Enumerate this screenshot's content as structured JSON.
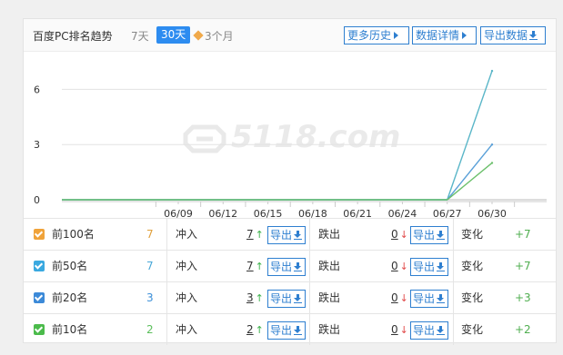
{
  "header": {
    "title": "百度PC排名趋势",
    "ranges": [
      "7天",
      "30天",
      "3个月"
    ],
    "active_range": "30天",
    "buttons": {
      "history": "更多历史",
      "detail": "数据详情",
      "export": "导出数据"
    }
  },
  "watermark": "5118.com",
  "chart_data": {
    "type": "line",
    "x": [
      "06/09",
      "06/12",
      "06/15",
      "06/18",
      "06/21",
      "06/24",
      "06/27",
      "06/30"
    ],
    "yticks": [
      0,
      3,
      6
    ],
    "ylim": [
      0,
      7.5
    ],
    "series": [
      {
        "color": "#5ab6c8",
        "values": [
          0,
          0,
          0,
          0,
          0,
          0,
          0,
          7
        ]
      },
      {
        "color": "#5aa0d8",
        "values": [
          0,
          0,
          0,
          0,
          0,
          0,
          0,
          3
        ]
      },
      {
        "color": "#6cc06c",
        "values": [
          0,
          0,
          0,
          0,
          0,
          0,
          0,
          2
        ]
      }
    ]
  },
  "rows": [
    {
      "label": "前100名",
      "count": "7",
      "count_color": "#e0a03c",
      "check_color": "#f0a33a",
      "rush_label": "冲入",
      "rush": "7",
      "drop_label": "跌出",
      "drop": "0",
      "export": "导出",
      "change_label": "变化",
      "change": "+7"
    },
    {
      "label": "前50名",
      "count": "7",
      "count_color": "#4aa8d8",
      "check_color": "#3aa9e0",
      "rush_label": "冲入",
      "rush": "7",
      "drop_label": "跌出",
      "drop": "0",
      "export": "导出",
      "change_label": "变化",
      "change": "+7"
    },
    {
      "label": "前20名",
      "count": "3",
      "count_color": "#3b8fd8",
      "check_color": "#3c8ad8",
      "rush_label": "冲入",
      "rush": "3",
      "drop_label": "跌出",
      "drop": "0",
      "export": "导出",
      "change_label": "变化",
      "change": "+3"
    },
    {
      "label": "前10名",
      "count": "2",
      "count_color": "#5cbf5c",
      "check_color": "#4bbb4b",
      "rush_label": "冲入",
      "rush": "2",
      "drop_label": "跌出",
      "drop": "0",
      "export": "导出",
      "change_label": "变化",
      "change": "+2"
    }
  ],
  "colors": {
    "accent": "#2e7fd0",
    "active_tab": "#2d8cf0",
    "up": "#3bb24a",
    "down": "#e14a4a",
    "change": "#4fae4f"
  }
}
